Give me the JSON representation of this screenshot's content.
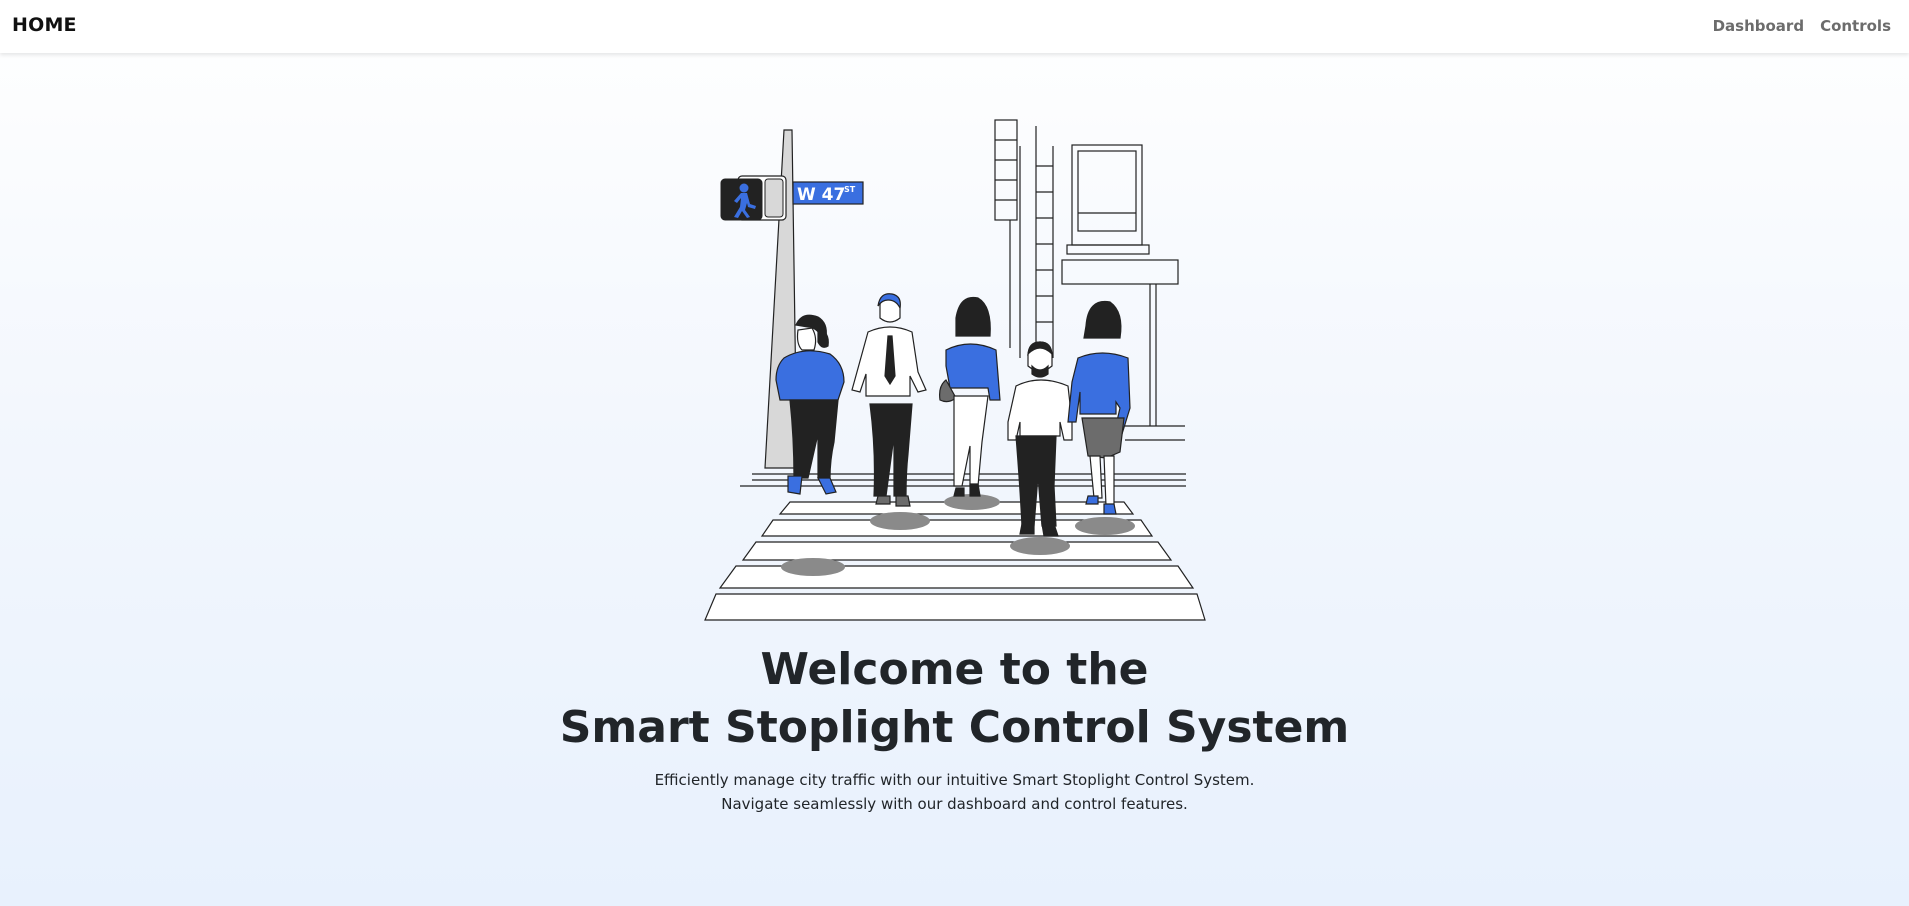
{
  "navbar": {
    "brand": "HOME",
    "links": [
      {
        "label": "Dashboard"
      },
      {
        "label": "Controls"
      }
    ]
  },
  "hero": {
    "street_sign": {
      "name": "W 47",
      "suffix": "ST"
    },
    "title_line1": "Welcome to the",
    "title_line2": "Smart Stoplight Control System",
    "subtitle_line1": "Efficiently manage city traffic with our intuitive Smart Stoplight Control System.",
    "subtitle_line2": "Navigate seamlessly with our dashboard and control features."
  },
  "colors": {
    "accent_blue": "#3a6fe0",
    "dark": "#212529",
    "nav_link": "#6c6c6c",
    "shadow_gray": "#8a8a8a"
  }
}
